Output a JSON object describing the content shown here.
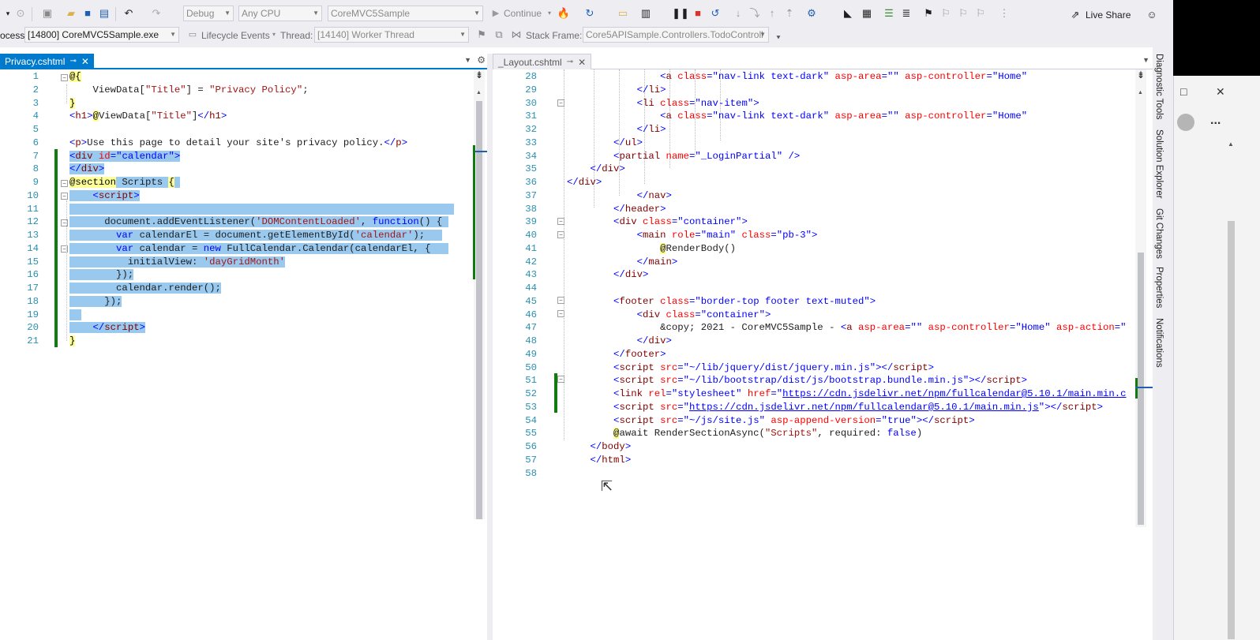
{
  "toolbar": {
    "config": "Debug",
    "platform": "Any CPU",
    "startup_project": "CoreMVC5Sample",
    "continue_label": "Continue",
    "live_share_label": "Live Share"
  },
  "debug_location": {
    "process_label": "ocess:",
    "process_value": "[14800] CoreMVC5Sample.exe",
    "lifecycle_label": "Lifecycle Events",
    "thread_label": "Thread:",
    "thread_value": "[14140] Worker Thread",
    "stack_frame_label": "Stack Frame:",
    "stack_frame_value": "Core5APISample.Controllers.TodoControll"
  },
  "left_editor": {
    "tab_label": "Privacy.cshtml",
    "pin_icon": "pin-icon",
    "line_numbers": [
      "1",
      "2",
      "3",
      "4",
      "5",
      "6",
      "7",
      "8",
      "9",
      "10",
      "11",
      "12",
      "13",
      "14",
      "15",
      "16",
      "17",
      "18",
      "19",
      "20",
      "21"
    ]
  },
  "right_editor": {
    "tab_label": "_Layout.cshtml",
    "line_numbers": [
      "28",
      "29",
      "30",
      "31",
      "32",
      "33",
      "34",
      "35",
      "36",
      "37",
      "38",
      "39",
      "40",
      "41",
      "42",
      "43",
      "44",
      "45",
      "46",
      "47",
      "48",
      "49",
      "50",
      "51",
      "52",
      "53",
      "54",
      "55",
      "56",
      "57",
      "58"
    ]
  },
  "side_tabs": [
    "Diagnostic Tools",
    "Solution Explorer",
    "Git Changes",
    "Properties",
    "Notifications"
  ],
  "window_controls": {
    "maximize": "□",
    "close": "✕",
    "more": "..."
  }
}
